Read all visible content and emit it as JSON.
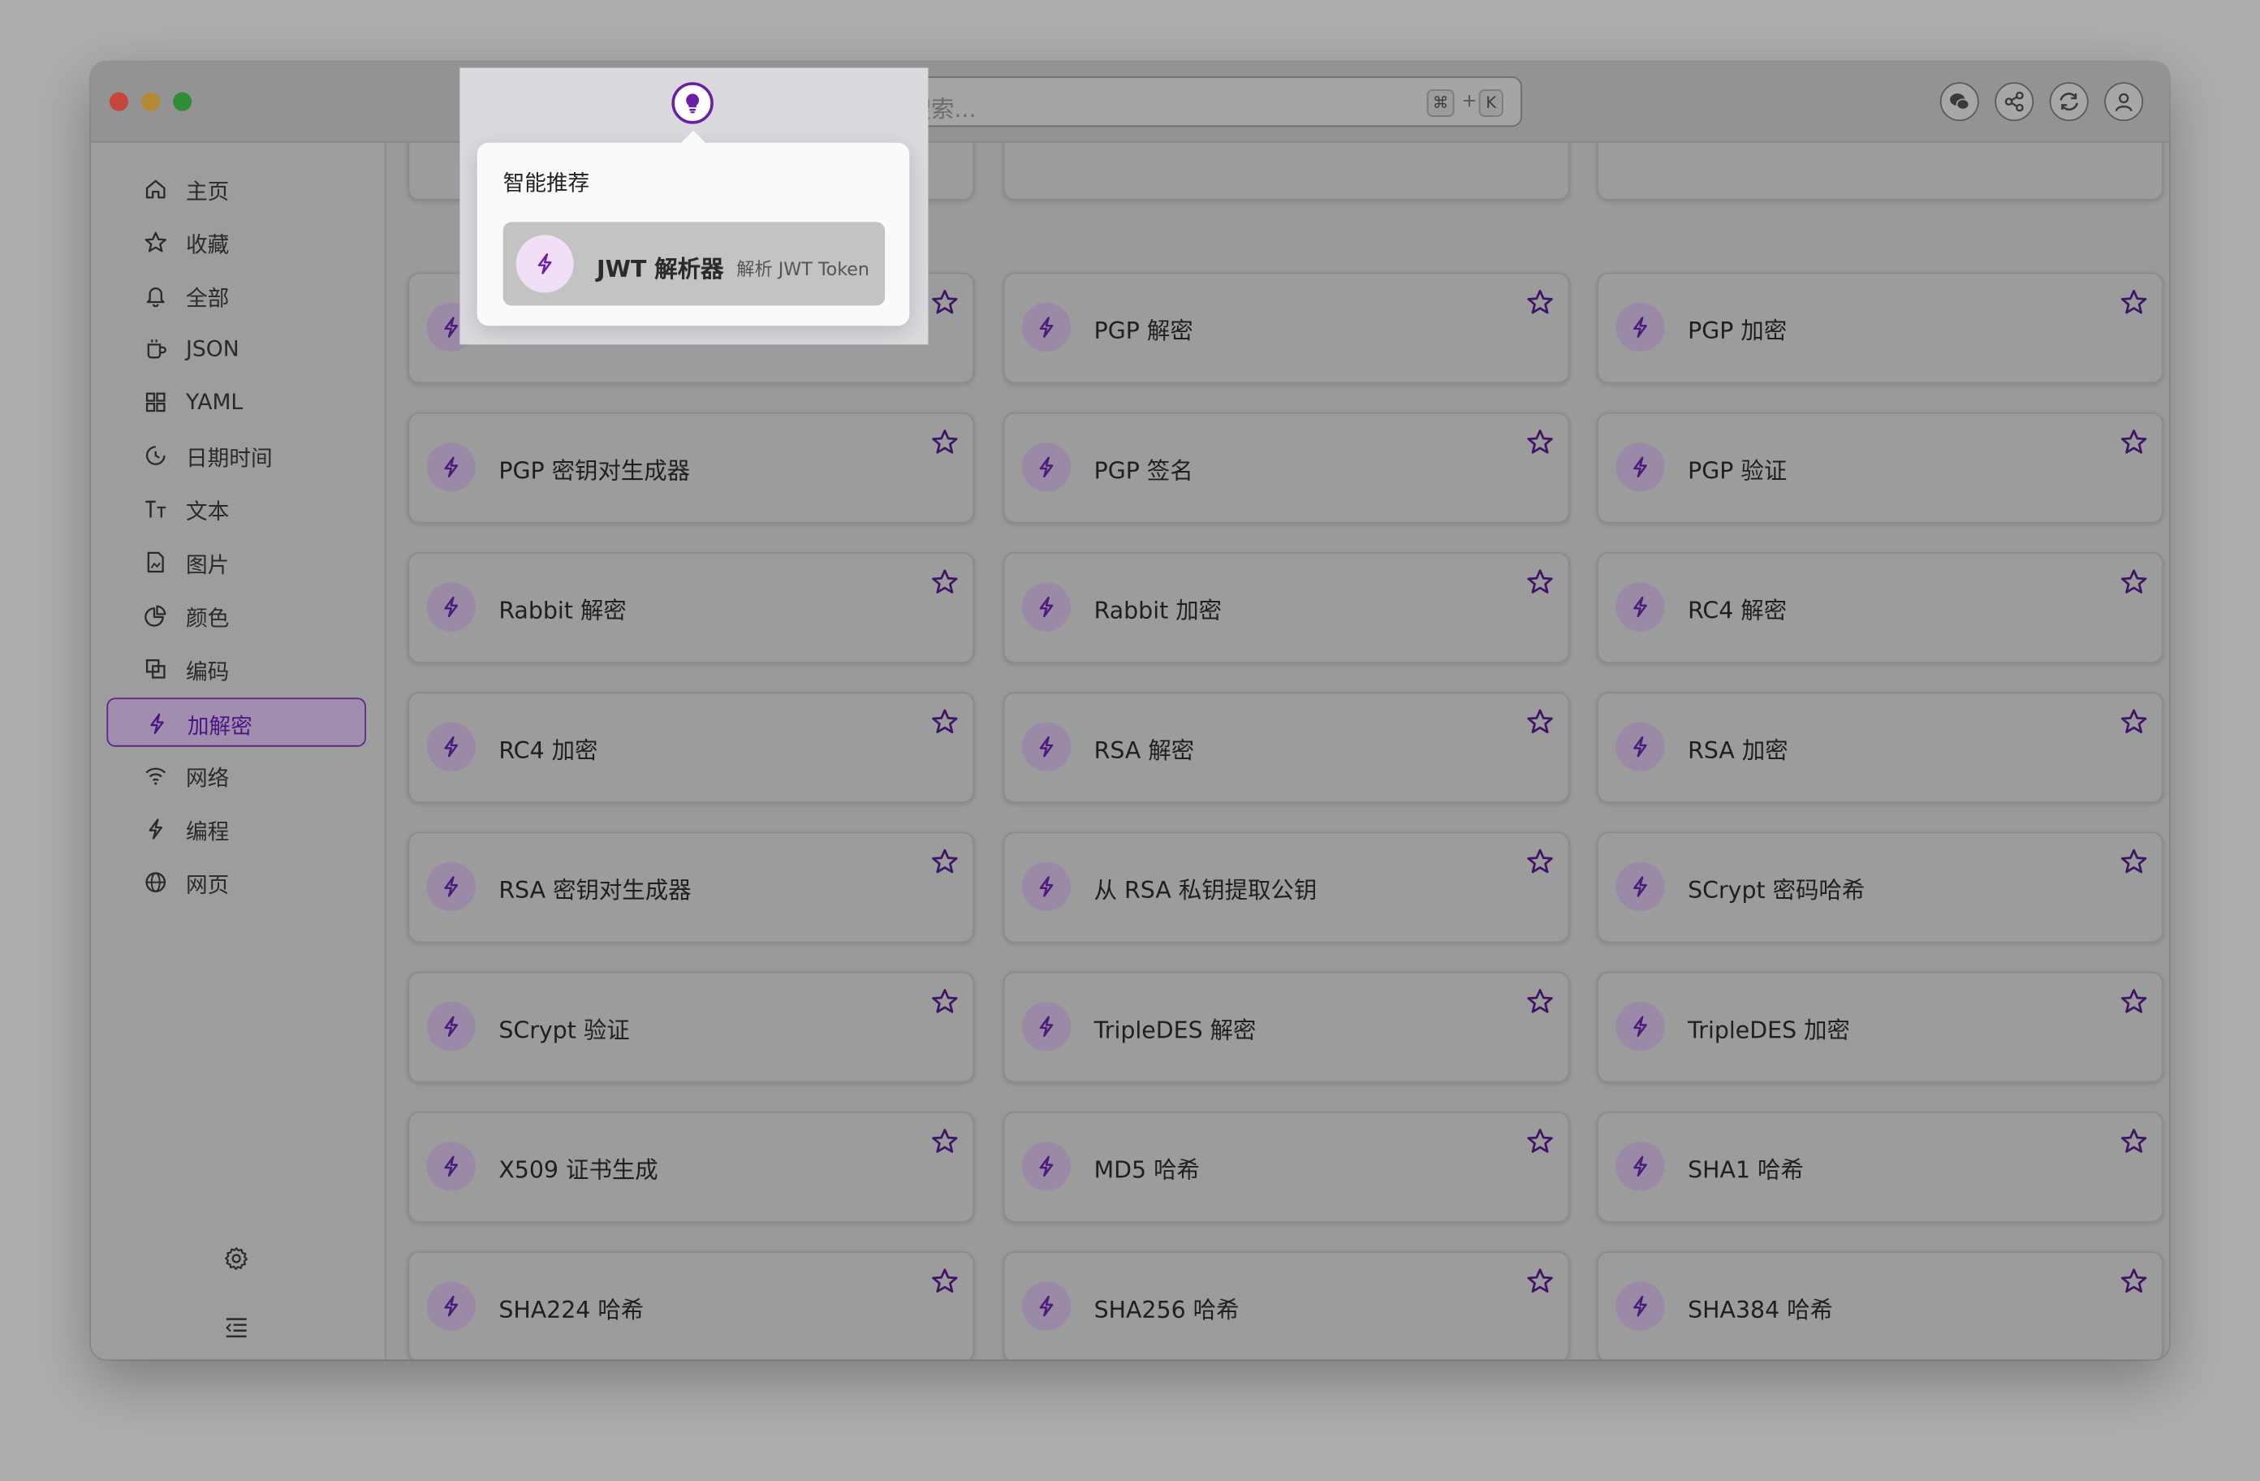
{
  "search": {
    "placeholder": "输入关键字搜索...",
    "shortcut_keys": [
      "⌘",
      "K"
    ],
    "shortcut_plus": "+"
  },
  "toolbar": {
    "icons": [
      "wechat-icon",
      "share-icon",
      "sync-icon",
      "user-icon"
    ]
  },
  "sidebar": {
    "items": [
      {
        "label": "主页",
        "icon": "home-icon"
      },
      {
        "label": "收藏",
        "icon": "star-icon"
      },
      {
        "label": "全部",
        "icon": "bell-icon"
      },
      {
        "label": "JSON",
        "icon": "mug-icon"
      },
      {
        "label": "YAML",
        "icon": "grid-icon"
      },
      {
        "label": "日期时间",
        "icon": "clock-icon"
      },
      {
        "label": "文本",
        "icon": "text-size-icon"
      },
      {
        "label": "图片",
        "icon": "file-image-icon"
      },
      {
        "label": "颜色",
        "icon": "pie-icon"
      },
      {
        "label": "编码",
        "icon": "copy-icon"
      },
      {
        "label": "加解密",
        "icon": "bolt-icon",
        "active": true
      },
      {
        "label": "网络",
        "icon": "wifi-icon"
      },
      {
        "label": "编程",
        "icon": "bolt-icon"
      },
      {
        "label": "网页",
        "icon": "globe-icon"
      }
    ],
    "bottom_icons": [
      "settings-icon",
      "collapse-menu-icon"
    ]
  },
  "popover": {
    "title": "智能推荐",
    "item": {
      "name": "JWT 解析器",
      "description": "解析 JWT Token"
    }
  },
  "tools": [
    "PGP 解密",
    "PGP 加密",
    "PGP 密钥对生成器",
    "PGP 签名",
    "PGP 验证",
    "Rabbit 解密",
    "Rabbit 加密",
    "RC4 解密",
    "RC4 加密",
    "RSA 解密",
    "RSA 加密",
    "RSA 密钥对生成器",
    "从 RSA 私钥提取公钥",
    "SCrypt 密码哈希",
    "SCrypt 验证",
    "TripleDES 解密",
    "TripleDES 加密",
    "X509 证书生成",
    "MD5 哈希",
    "SHA1 哈希",
    "SHA224 哈希",
    "SHA256 哈希",
    "SHA384 哈希"
  ],
  "colors": {
    "accent": "#6a1fa8",
    "active_border": "#5b2588"
  }
}
